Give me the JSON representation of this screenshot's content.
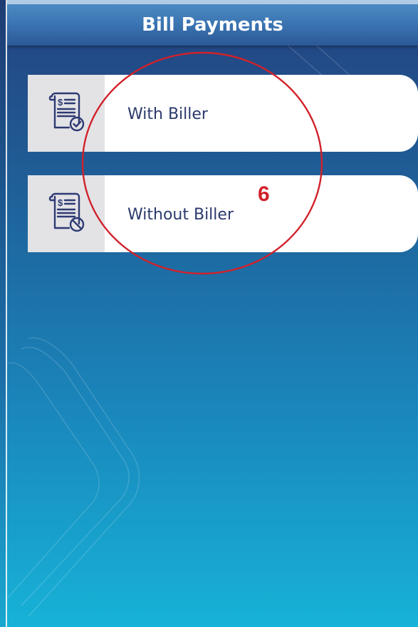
{
  "header": {
    "title": "Bill Payments"
  },
  "options": [
    {
      "label": "With Biller",
      "icon": "bill-check-icon"
    },
    {
      "label": "Without Biller",
      "icon": "bill-block-icon"
    }
  ],
  "annotation": {
    "number": "6",
    "color": "#d1212a"
  },
  "colors": {
    "header": "#3a73b1",
    "background_top": "#24427f",
    "background_bottom": "#17b2d7",
    "icon_stroke": "#2e3a73",
    "label_text": "#2b3a6b"
  }
}
